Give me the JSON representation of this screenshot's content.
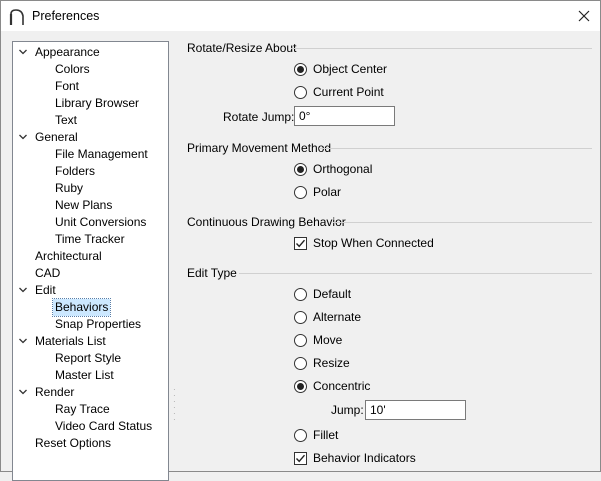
{
  "window": {
    "title": "Preferences"
  },
  "tree": {
    "items": [
      {
        "label": "Appearance",
        "level": 0,
        "expandable": true
      },
      {
        "label": "Colors",
        "level": 1
      },
      {
        "label": "Font",
        "level": 1
      },
      {
        "label": "Library Browser",
        "level": 1
      },
      {
        "label": "Text",
        "level": 1
      },
      {
        "label": "General",
        "level": 0,
        "expandable": true
      },
      {
        "label": "File Management",
        "level": 1
      },
      {
        "label": "Folders",
        "level": 1
      },
      {
        "label": "Ruby",
        "level": 1
      },
      {
        "label": "New Plans",
        "level": 1
      },
      {
        "label": "Unit Conversions",
        "level": 1
      },
      {
        "label": "Time Tracker",
        "level": 1
      },
      {
        "label": "Architectural",
        "level": 0
      },
      {
        "label": "CAD",
        "level": 0
      },
      {
        "label": "Edit",
        "level": 0,
        "expandable": true
      },
      {
        "label": "Behaviors",
        "level": 1,
        "selected": true
      },
      {
        "label": "Snap Properties",
        "level": 1
      },
      {
        "label": "Materials List",
        "level": 0,
        "expandable": true
      },
      {
        "label": "Report Style",
        "level": 1
      },
      {
        "label": "Master List",
        "level": 1
      },
      {
        "label": "Render",
        "level": 0,
        "expandable": true
      },
      {
        "label": "Ray Trace",
        "level": 1
      },
      {
        "label": "Video Card Status",
        "level": 1
      },
      {
        "label": "Reset Options",
        "level": 0
      }
    ]
  },
  "rotate": {
    "header": "Rotate/Resize About",
    "object_center": "Object Center",
    "current_point": "Current Point",
    "jump_label": "Rotate Jump:",
    "jump_value": "0°"
  },
  "movement": {
    "header": "Primary Movement Method",
    "orthogonal": "Orthogonal",
    "polar": "Polar"
  },
  "continuous": {
    "header": "Continuous Drawing Behavior",
    "stop_when_connected": "Stop When Connected"
  },
  "edit_type": {
    "header": "Edit Type",
    "default": "Default",
    "alternate": "Alternate",
    "move": "Move",
    "resize": "Resize",
    "concentric": "Concentric",
    "jump_label": "Jump:",
    "jump_value": "10'",
    "fillet": "Fillet",
    "behavior_indicators": "Behavior Indicators"
  }
}
